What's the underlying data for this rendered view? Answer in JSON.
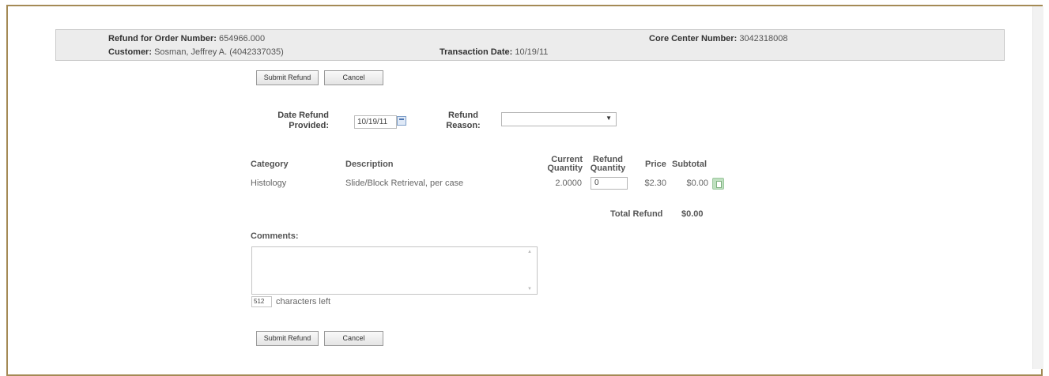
{
  "header": {
    "order_label": "Refund for Order Number:",
    "order_value": "654966.000",
    "core_label": "Core Center Number:",
    "core_value": "3042318008",
    "customer_label": "Customer:",
    "customer_value": "Sosman, Jeffrey A. (4042337035)",
    "date_label": "Transaction Date:",
    "date_value": "10/19/11"
  },
  "buttons": {
    "submit": "Submit Refund",
    "cancel": "Cancel"
  },
  "form": {
    "date_refund_label_line1": "Date Refund",
    "date_refund_label_line2": "Provided:",
    "date_refund_value": "10/19/11",
    "reason_label_line1": "Refund",
    "reason_label_line2": "Reason:",
    "reason_value": ""
  },
  "table": {
    "headers": {
      "category": "Category",
      "description": "Description",
      "current_qty_line1": "Current",
      "current_qty_line2": "Quantity",
      "refund_qty_line1": "Refund",
      "refund_qty_line2": "Quantity",
      "price": "Price",
      "subtotal": "Subtotal"
    },
    "rows": [
      {
        "category": "Histology",
        "description": "Slide/Block Retrieval, per case",
        "current_quantity": "2.0000",
        "refund_quantity": "0",
        "price": "$2.30",
        "subtotal": "$0.00"
      }
    ],
    "total_label": "Total Refund",
    "total_value": "$0.00"
  },
  "comments": {
    "label": "Comments:",
    "value": "",
    "chars_left_value": "512",
    "chars_left_label": "characters left"
  },
  "icons": {
    "calendar": "calendar-icon",
    "details": "document-icon"
  },
  "colors": {
    "frame_border": "#a48a55",
    "header_bg": "#ececec"
  }
}
